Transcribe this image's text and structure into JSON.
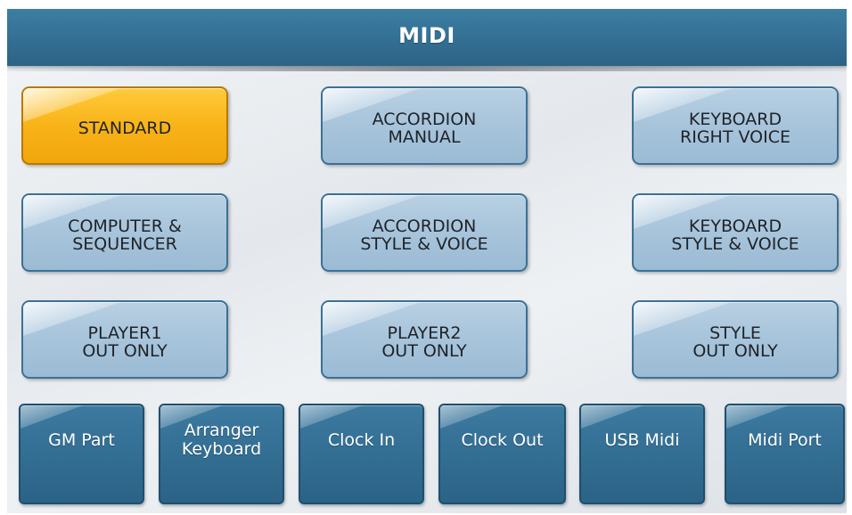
{
  "header": {
    "title": "MIDI"
  },
  "presets": [
    {
      "label": "STANDARD",
      "selected": true
    },
    {
      "label": "ACCORDION\nMANUAL",
      "selected": false
    },
    {
      "label": "KEYBOARD\nRIGHT VOICE",
      "selected": false
    },
    {
      "label": "COMPUTER &\nSEQUENCER",
      "selected": false
    },
    {
      "label": "ACCORDION\nSTYLE & VOICE",
      "selected": false
    },
    {
      "label": "KEYBOARD\nSTYLE & VOICE",
      "selected": false
    },
    {
      "label": "PLAYER1\nOUT ONLY",
      "selected": false
    },
    {
      "label": "PLAYER2\nOUT ONLY",
      "selected": false
    },
    {
      "label": "STYLE\nOUT ONLY",
      "selected": false
    }
  ],
  "tabs": [
    {
      "label": "GM Part"
    },
    {
      "label": "Arranger\nKeyboard"
    },
    {
      "label": "Clock In"
    },
    {
      "label": "Clock Out"
    },
    {
      "label": "USB Midi"
    },
    {
      "label": "Midi Port"
    }
  ],
  "colors": {
    "header_bg": "#336f93",
    "preset_bg": "#a7c4db",
    "preset_selected_bg": "#f8b318",
    "tab_bg": "#326d92",
    "tab_text": "#ffffff"
  }
}
